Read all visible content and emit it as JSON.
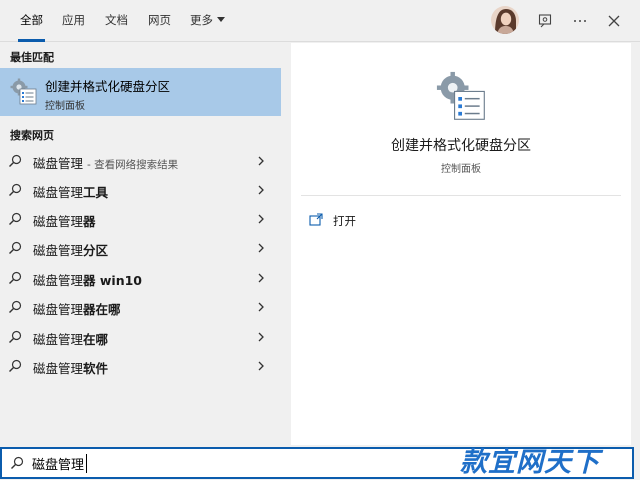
{
  "tabs": [
    {
      "label": "全部",
      "active": true
    },
    {
      "label": "应用",
      "active": false
    },
    {
      "label": "文档",
      "active": false
    },
    {
      "label": "网页",
      "active": false
    },
    {
      "label": "更多",
      "active": false
    }
  ],
  "top_icons": [
    "avatar",
    "feedback-icon",
    "more-options-icon",
    "close-icon"
  ],
  "left": {
    "best_match_title": "最佳匹配",
    "best_match": {
      "title": "创建并格式化硬盘分区",
      "subtitle": "控制面板",
      "icon": "disk-management-icon"
    },
    "web_search_title": "搜索网页",
    "web_results": [
      {
        "prefix": "磁盘管理",
        "bold": "",
        "hint": "- 查看网络搜索结果"
      },
      {
        "prefix": "磁盘管理",
        "bold": "工具",
        "hint": ""
      },
      {
        "prefix": "磁盘管理",
        "bold": "器",
        "hint": ""
      },
      {
        "prefix": "磁盘管理",
        "bold": "分区",
        "hint": ""
      },
      {
        "prefix": "磁盘管理",
        "bold": "器 win10",
        "hint": ""
      },
      {
        "prefix": "磁盘管理",
        "bold": "器在哪",
        "hint": ""
      },
      {
        "prefix": "磁盘管理",
        "bold": "在哪",
        "hint": ""
      },
      {
        "prefix": "磁盘管理",
        "bold": "软件",
        "hint": ""
      }
    ]
  },
  "right": {
    "title": "创建并格式化硬盘分区",
    "subtitle": "控制面板",
    "actions": [
      {
        "label": "打开",
        "icon": "open-window-icon"
      }
    ]
  },
  "search": {
    "value": "磁盘管理",
    "placeholder": ""
  },
  "watermark": "款宜网天下",
  "colors": {
    "accent": "#0b5cad",
    "selected_bg": "#a8c9e8",
    "panel_bg": "#f0f0f0",
    "detail_bg": "#ffffff",
    "watermark": "#1f6fc8"
  }
}
